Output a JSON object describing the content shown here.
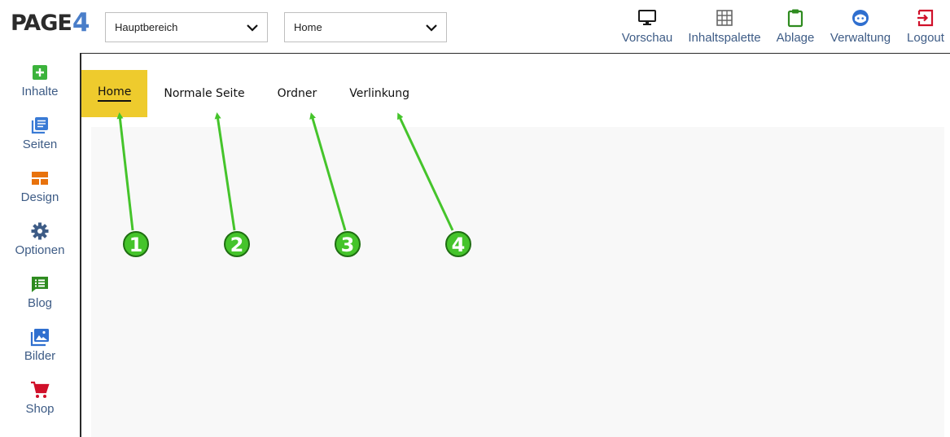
{
  "logo": {
    "part1": "PAGE",
    "part2": "4"
  },
  "selects": {
    "area": {
      "value": "Hauptbereich"
    },
    "page": {
      "value": "Home"
    }
  },
  "toolbar": [
    {
      "label": "Vorschau",
      "icon": "monitor-icon",
      "color": "#1a1a1a"
    },
    {
      "label": "Inhaltspalette",
      "icon": "grid-icon",
      "color": "#666666"
    },
    {
      "label": "Ablage",
      "icon": "clipboard-icon",
      "color": "#2e8b1f"
    },
    {
      "label": "Verwaltung",
      "icon": "face-icon",
      "color": "#2f6fcf"
    },
    {
      "label": "Logout",
      "icon": "logout-icon",
      "color": "#d0102a"
    }
  ],
  "sidebar": {
    "items": [
      {
        "label": "Inhalte",
        "icon": "plus-square-icon",
        "color": "#3bb33b"
      },
      {
        "label": "Seiten",
        "icon": "pages-icon",
        "color": "#3a7bd5"
      },
      {
        "label": "Design",
        "icon": "layout-icon",
        "color": "#e8720c"
      },
      {
        "label": "Optionen",
        "icon": "gear-icon",
        "color": "#3e5c86"
      },
      {
        "label": "Blog",
        "icon": "blog-icon",
        "color": "#2e8b1f"
      },
      {
        "label": "Bilder",
        "icon": "images-icon",
        "color": "#2f6fcf"
      },
      {
        "label": "Shop",
        "icon": "cart-icon",
        "color": "#d0102a"
      }
    ]
  },
  "site_nav": {
    "items": [
      {
        "label": "Home",
        "active": true
      },
      {
        "label": "Normale Seite",
        "active": false
      },
      {
        "label": "Ordner",
        "active": false
      },
      {
        "label": "Verlinkung",
        "active": false
      }
    ],
    "active_color": "#eecb2d"
  },
  "annotations": {
    "color": "#45c42b",
    "markers": [
      "1",
      "2",
      "3",
      "4"
    ]
  }
}
